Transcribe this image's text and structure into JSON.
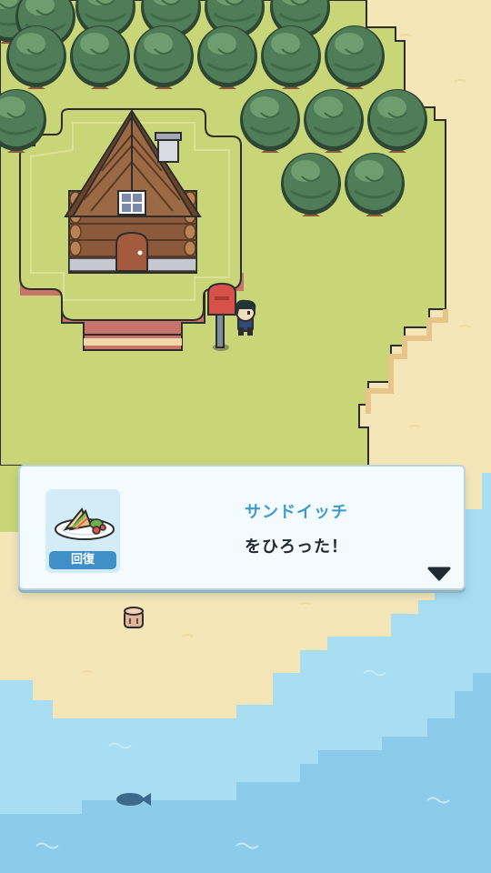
{
  "dialog": {
    "item_name": "サンドイッチ",
    "message": "をひろった！",
    "item_icon": "sandwich-icon",
    "item_badge": "回復",
    "advance_icon": "chevron-down-icon"
  },
  "colors": {
    "grass": "#c9d677",
    "sand": "#f5e6b8",
    "water_shallow": "#a8ddf2",
    "water_deep": "#8ccbea",
    "accent": "#3d9ccd"
  }
}
